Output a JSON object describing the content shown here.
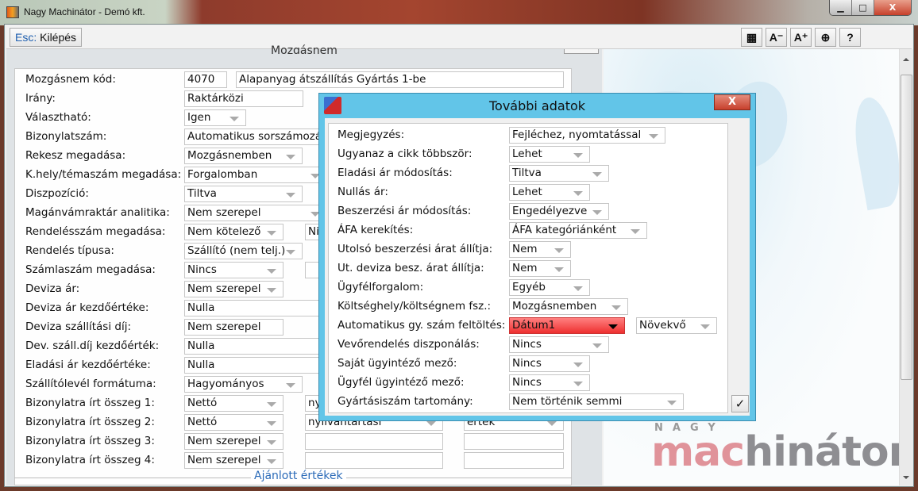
{
  "window": {
    "title": "Nagy Machinátor - Demó kft.",
    "minimize": "▁",
    "maximize": "□",
    "close": "X"
  },
  "toolbar": {
    "esc_key": "Esc:",
    "esc_label": "Kilépés",
    "buttons": [
      {
        "icon": "grid-icon",
        "label": "▦"
      },
      {
        "icon": "font-decrease-icon",
        "label": "A⁻"
      },
      {
        "icon": "font-increase-icon",
        "label": "A⁺"
      },
      {
        "icon": "lifebuoy-icon",
        "label": "⊕"
      },
      {
        "icon": "help-icon",
        "label": "?"
      }
    ]
  },
  "section": {
    "title": "Mozgásnem"
  },
  "form": {
    "rows": [
      {
        "label": "Mozgásnem kód:",
        "controls": [
          {
            "type": "text",
            "value": "4070"
          },
          {
            "type": "text",
            "value": "Alapanyag átszállítás Gyártás 1-be"
          }
        ]
      },
      {
        "label": "Irány:",
        "controls": [
          {
            "type": "text",
            "value": "Raktárközi"
          }
        ]
      },
      {
        "label": "Választható:",
        "controls": [
          {
            "type": "combo",
            "value": "Igen"
          }
        ]
      },
      {
        "label": "Bizonylatszám:",
        "controls": [
          {
            "type": "text",
            "value": "Automatikus sorszámozá"
          }
        ]
      },
      {
        "label": "Rekesz megadása:",
        "controls": [
          {
            "type": "combo",
            "value": "Mozgásnemben"
          }
        ]
      },
      {
        "label": "K.hely/témaszám megadása:",
        "controls": [
          {
            "type": "combo",
            "value": "Forgalomban"
          }
        ]
      },
      {
        "label": "Diszpozíció:",
        "controls": [
          {
            "type": "combo",
            "value": "Tiltva"
          }
        ]
      },
      {
        "label": "Magánvámraktár analitika:",
        "controls": [
          {
            "type": "combo",
            "value": "Nem szerepel"
          }
        ]
      },
      {
        "label": "Rendelésszám megadása:",
        "controls": [
          {
            "type": "combo",
            "value": "Nem kötelező"
          },
          {
            "type": "text",
            "value": "Ni"
          }
        ]
      },
      {
        "label": "Rendelés típusa:",
        "controls": [
          {
            "type": "combo",
            "value": "Szállító (nem telj.)"
          }
        ]
      },
      {
        "label": "Számlaszám megadása:",
        "controls": [
          {
            "type": "combo",
            "value": "Nincs"
          },
          {
            "type": "text",
            "value": ""
          }
        ]
      },
      {
        "label": "Deviza ár:",
        "controls": [
          {
            "type": "combo",
            "value": "Nem szerepel"
          }
        ]
      },
      {
        "label": "Deviza ár kezdőértéke:",
        "controls": [
          {
            "type": "text",
            "value": "Nulla"
          }
        ]
      },
      {
        "label": "Deviza szállítási díj:",
        "controls": [
          {
            "type": "text",
            "value": "Nem szerepel"
          }
        ]
      },
      {
        "label": "Dev. száll.díj kezdőérték:",
        "controls": [
          {
            "type": "text",
            "value": "Nulla"
          }
        ]
      },
      {
        "label": "Eladási ár kezdőértéke:",
        "controls": [
          {
            "type": "text",
            "value": "Nulla"
          }
        ]
      },
      {
        "label": "Szállítólevél formátuma:",
        "controls": [
          {
            "type": "combo",
            "value": "Hagyományos"
          }
        ]
      },
      {
        "label": "Bizonylatra írt összeg 1:",
        "controls": [
          {
            "type": "combo",
            "value": "Nettó"
          },
          {
            "type": "combo",
            "value": "ny"
          },
          {
            "type": "combo",
            "value": ""
          }
        ]
      },
      {
        "label": "Bizonylatra írt összeg 2:",
        "controls": [
          {
            "type": "combo",
            "value": "Nettó"
          },
          {
            "type": "combo",
            "value": "nyilvántartási"
          },
          {
            "type": "combo",
            "value": "érték"
          }
        ]
      },
      {
        "label": "Bizonylatra írt összeg 3:",
        "controls": [
          {
            "type": "combo",
            "value": "Nem szerepel"
          },
          {
            "type": "text",
            "value": ""
          },
          {
            "type": "text",
            "value": ""
          }
        ]
      },
      {
        "label": "Bizonylatra írt összeg 4:",
        "controls": [
          {
            "type": "combo",
            "value": "Nem szerepel"
          },
          {
            "type": "text",
            "value": ""
          },
          {
            "type": "text",
            "value": ""
          }
        ]
      }
    ],
    "recommended_label": "Ajánlott értékek"
  },
  "dialog": {
    "title": "További adatok",
    "close": "X",
    "ok": "✓",
    "rows": [
      {
        "label": "Megjegyzés:",
        "value": "Fejléchez, nyomtatással"
      },
      {
        "label": "Ugyanaz a cikk többször:",
        "value": "Lehet"
      },
      {
        "label": "Eladási ár módosítás:",
        "value": "Tiltva"
      },
      {
        "label": "Nullás ár:",
        "value": "Lehet"
      },
      {
        "label": "Beszerzési ár módosítás:",
        "value": "Engedélyezve"
      },
      {
        "label": "ÁFA kerekítés:",
        "value": "ÁFA kategóriánként"
      },
      {
        "label": "Utolsó beszerzési árat állítja:",
        "value": "Nem"
      },
      {
        "label": "Ut. deviza besz. árat állítja:",
        "value": "Nem"
      },
      {
        "label": "Ügyfélforgalom:",
        "value": "Egyéb"
      },
      {
        "label": "Költséghely/költségnem fsz.:",
        "value": "Mozgásnemben"
      },
      {
        "label": "Automatikus gy. szám feltöltés:",
        "value": "Dátum1",
        "extra": "Növekvő",
        "error": true
      },
      {
        "label": "Vevőrendelés diszponálás:",
        "value": "Nincs"
      },
      {
        "label": "Saját ügyintéző mező:",
        "value": "Nincs"
      },
      {
        "label": "Ügyfél ügyintéző mező:",
        "value": "Nincs"
      },
      {
        "label": "Gyártásiszám tartomány:",
        "value": "Nem történik semmi"
      }
    ]
  },
  "logo": {
    "small": "NAGY",
    "part1": "mac",
    "part2": "hinátor"
  },
  "colors": {
    "dialog_title": "#62c5e8",
    "error_field": "#ee3030",
    "link": "#2a6ab8"
  }
}
